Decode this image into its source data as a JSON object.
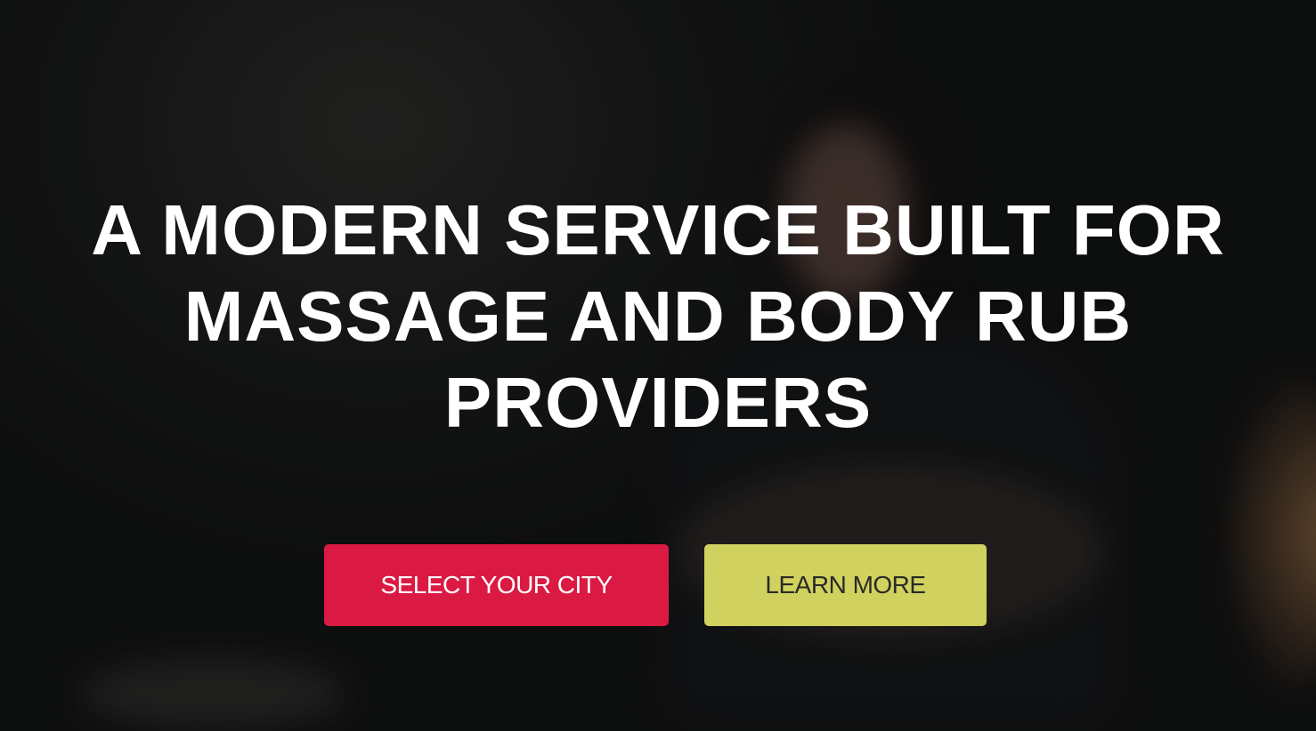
{
  "hero": {
    "headline_lines": [
      "A MODERN SERVICE BUILT FOR",
      "MASSAGE AND BODY RUB",
      "PROVIDERS"
    ]
  },
  "buttons": {
    "select_city": "SELECT YOUR CITY",
    "learn_more": "LEARN MORE"
  },
  "colors": {
    "primary": "#da1a43",
    "secondary": "#d1d160"
  }
}
